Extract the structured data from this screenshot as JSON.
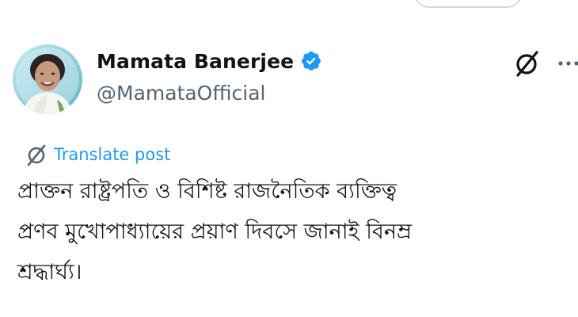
{
  "author": {
    "display_name": "Mamata Banerjee",
    "handle": "@MamataOfficial",
    "verified": true,
    "verified_badge_color": "#1d9bf0",
    "avatar": "profile-photo"
  },
  "actions": {
    "grok_icon": "grok-slash-circle-icon",
    "more_icon": "more-horizontal-icon"
  },
  "translate": {
    "label": "Translate post",
    "icon": "grok-slash-circle-icon",
    "color": "#1d9bf0"
  },
  "post": {
    "text": "প্রাক্তন রাষ্ট্রপতি ও বিশিষ্ট রাজনৈতিক ব্যক্তিত্ব\nপ্রণব মুখোপাধ্যায়ের প্রয়াণ দিবসে জানাই বিনম্র\nশ্রদ্ধার্ঘ্য।"
  },
  "colors": {
    "text_primary": "#0f1419",
    "text_secondary": "#536471",
    "border": "#cfd9de"
  }
}
